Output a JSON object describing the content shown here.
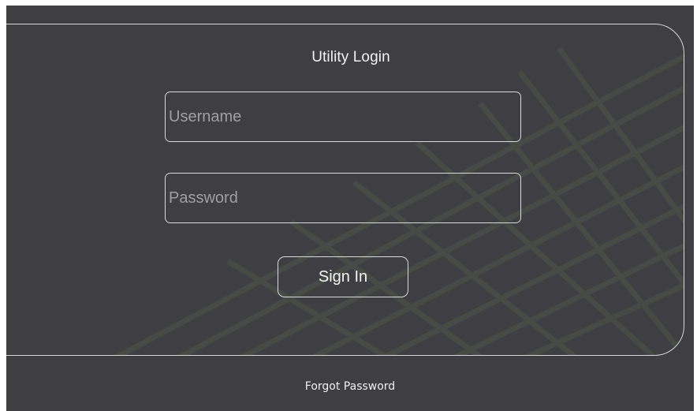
{
  "login": {
    "title": "Utility Login",
    "username_placeholder": "Username",
    "username_value": "",
    "password_placeholder": "Password",
    "password_value": "",
    "signin_label": "Sign In",
    "forgot_label": "Forgot Password"
  },
  "colors": {
    "background": "#3f3e42",
    "border": "#d9d9d9",
    "text": "#f2f2f2",
    "placeholder": "#9f9fa3"
  }
}
